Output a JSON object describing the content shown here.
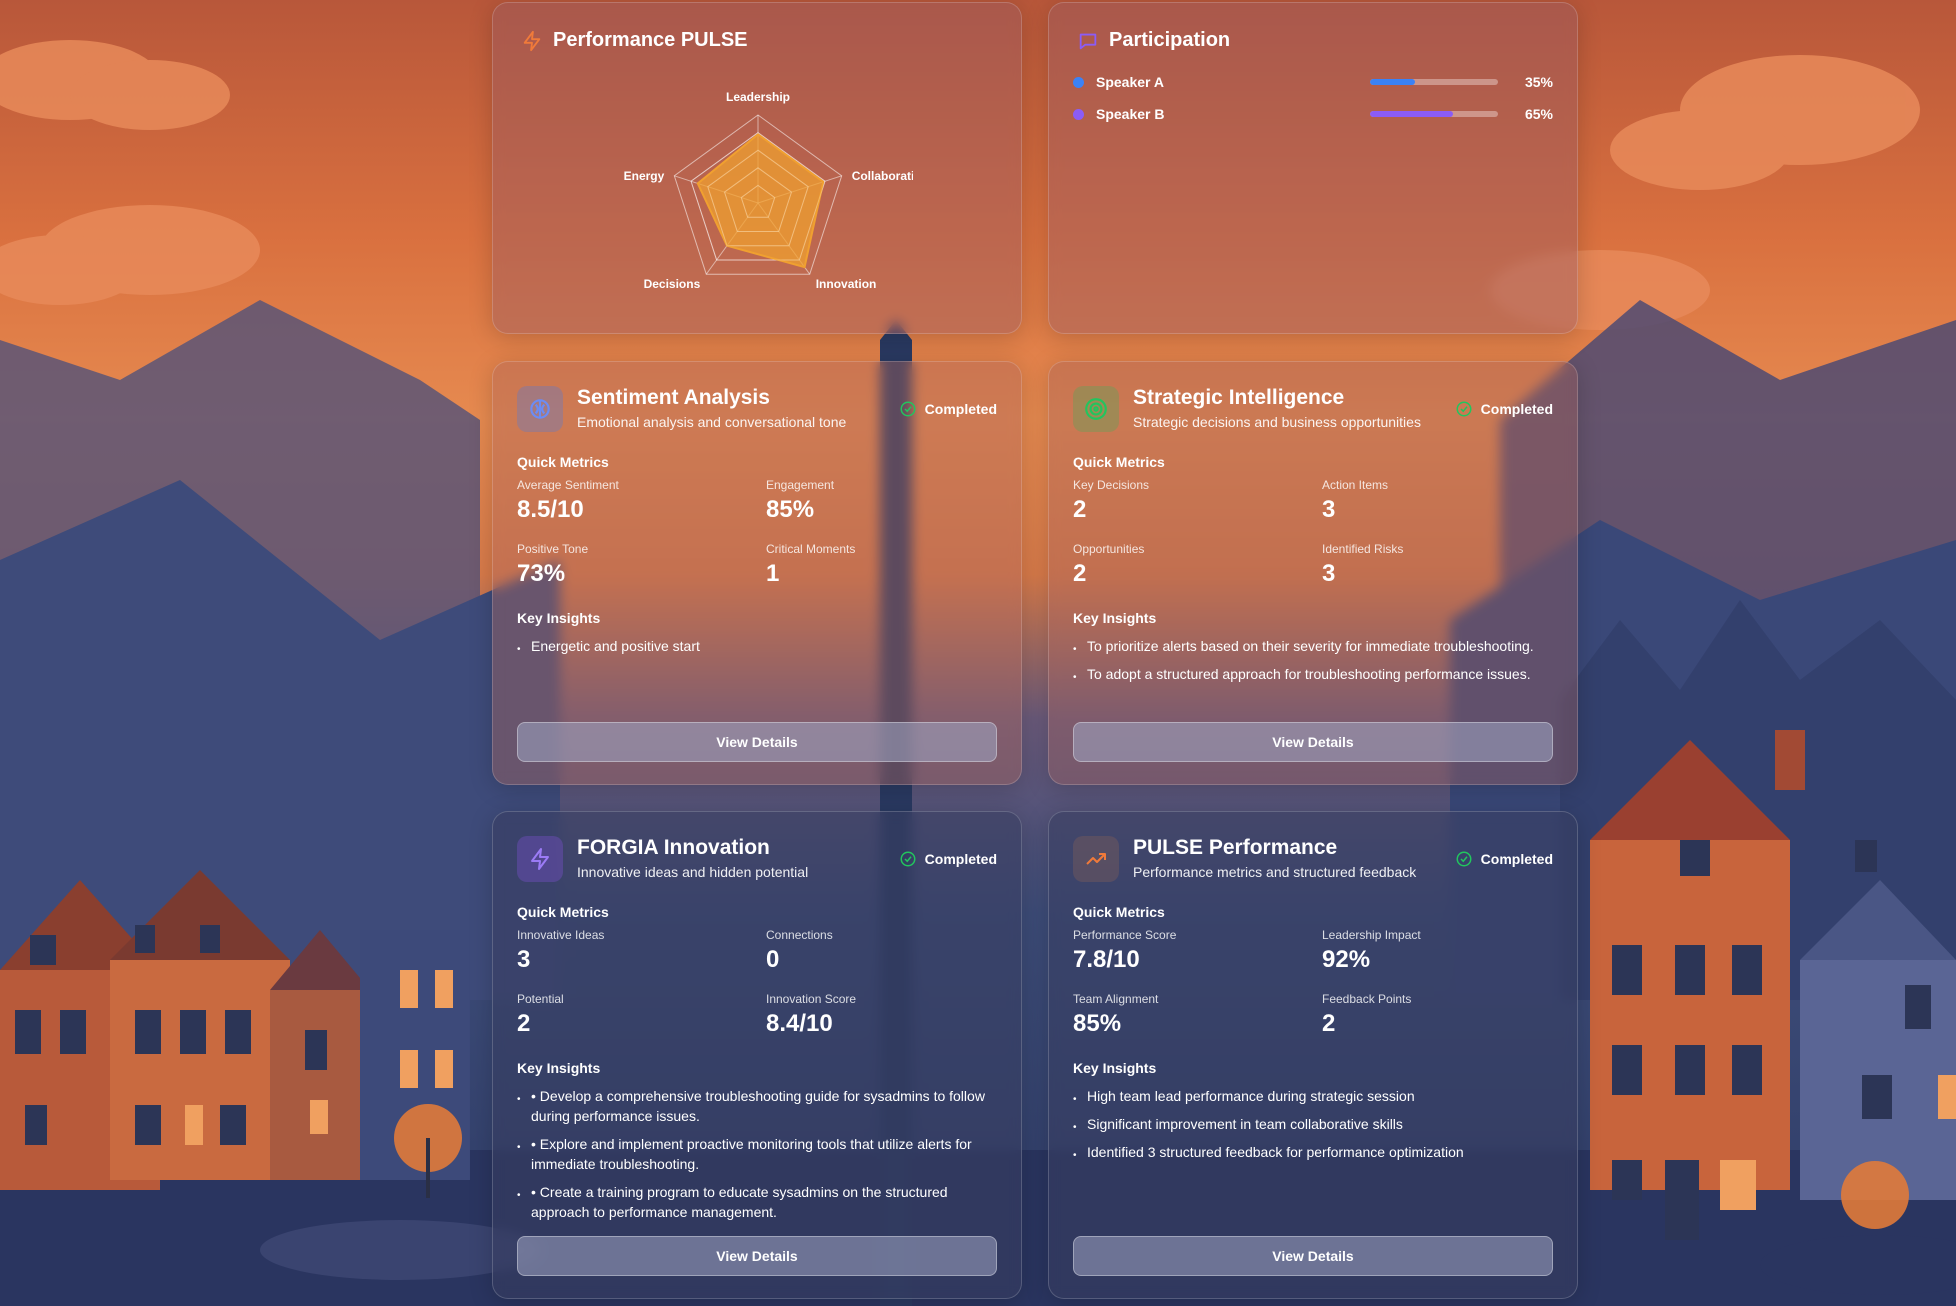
{
  "performance_pulse": {
    "title": "Performance PULSE",
    "radar": {
      "axes": [
        "Leadership",
        "Collaboration",
        "Innovation",
        "Decisions",
        "Energy"
      ],
      "values": [
        0.78,
        0.78,
        0.9,
        0.6,
        0.72
      ],
      "color": "#f0a030"
    }
  },
  "participation": {
    "title": "Participation",
    "speakers": [
      {
        "name": "Speaker A",
        "percent": "35%",
        "value": 0.35,
        "color": "#3b82f6"
      },
      {
        "name": "Speaker B",
        "percent": "65%",
        "value": 0.65,
        "color": "#8b5cf6"
      }
    ]
  },
  "cards": [
    {
      "title": "Sentiment Analysis",
      "subtitle": "Emotional analysis and conversational tone",
      "status": "Completed",
      "icon": "brain-icon",
      "quick_metrics_label": "Quick Metrics",
      "metrics": [
        {
          "label": "Average Sentiment",
          "value": "8.5/10"
        },
        {
          "label": "Engagement",
          "value": "85%"
        },
        {
          "label": "Positive Tone",
          "value": "73%"
        },
        {
          "label": "Critical Moments",
          "value": "1"
        }
      ],
      "key_insights_label": "Key Insights",
      "insights": [
        "Energetic and positive start"
      ],
      "button": "View Details"
    },
    {
      "title": "Strategic Intelligence",
      "subtitle": "Strategic decisions and business opportunities",
      "status": "Completed",
      "icon": "target-icon",
      "quick_metrics_label": "Quick Metrics",
      "metrics": [
        {
          "label": "Key Decisions",
          "value": "2"
        },
        {
          "label": "Action Items",
          "value": "3"
        },
        {
          "label": "Opportunities",
          "value": "2"
        },
        {
          "label": "Identified Risks",
          "value": "3"
        }
      ],
      "key_insights_label": "Key Insights",
      "insights": [
        "To prioritize alerts based on their severity for immediate troubleshooting.",
        "To adopt a structured approach for troubleshooting performance issues."
      ],
      "button": "View Details"
    },
    {
      "title": "FORGIA Innovation",
      "subtitle": "Innovative ideas and hidden potential",
      "status": "Completed",
      "icon": "lightning-icon",
      "quick_metrics_label": "Quick Metrics",
      "metrics": [
        {
          "label": "Innovative Ideas",
          "value": "3"
        },
        {
          "label": "Connections",
          "value": "0"
        },
        {
          "label": "Potential",
          "value": "2"
        },
        {
          "label": "Innovation Score",
          "value": "8.4/10"
        }
      ],
      "key_insights_label": "Key Insights",
      "insights": [
        "• Develop a comprehensive troubleshooting guide for sysadmins to follow during performance issues.",
        "• Explore and implement proactive monitoring tools that utilize alerts for immediate troubleshooting.",
        "• Create a training program to educate sysadmins on the structured approach to performance management."
      ],
      "button": "View Details"
    },
    {
      "title": "PULSE Performance",
      "subtitle": "Performance metrics and structured feedback",
      "status": "Completed",
      "icon": "trending-up-icon",
      "quick_metrics_label": "Quick Metrics",
      "metrics": [
        {
          "label": "Performance Score",
          "value": "7.8/10"
        },
        {
          "label": "Leadership Impact",
          "value": "92%"
        },
        {
          "label": "Team Alignment",
          "value": "85%"
        },
        {
          "label": "Feedback Points",
          "value": "2"
        }
      ],
      "key_insights_label": "Key Insights",
      "insights": [
        "High team lead performance during strategic session",
        "Significant improvement in team collaborative skills",
        "Identified 3 structured feedback for performance optimization"
      ],
      "button": "View Details"
    }
  ]
}
